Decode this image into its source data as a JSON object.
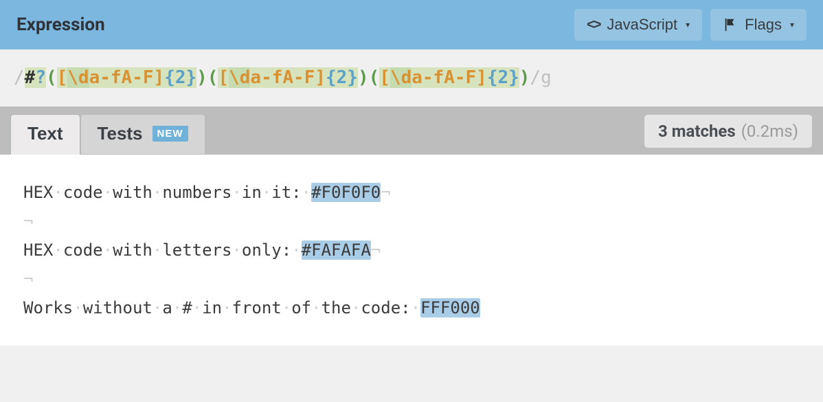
{
  "header": {
    "title": "Expression",
    "flavor_label": "JavaScript",
    "flags_label": "Flags"
  },
  "expression": {
    "open_delim": "/",
    "close_delim": "/",
    "flags": "g",
    "tokens": [
      {
        "t": "lit",
        "v": "#"
      },
      {
        "t": "qm",
        "v": "?"
      },
      {
        "t": "paren",
        "v": "("
      },
      {
        "t": "brk",
        "v": "["
      },
      {
        "t": "esc",
        "v": "\\d"
      },
      {
        "t": "brk",
        "v": "a-fA-F"
      },
      {
        "t": "brk",
        "v": "]"
      },
      {
        "t": "quant",
        "v": "{2}"
      },
      {
        "t": "paren",
        "v": ")"
      },
      {
        "t": "paren",
        "v": "("
      },
      {
        "t": "brk",
        "v": "["
      },
      {
        "t": "esc",
        "v": "\\d"
      },
      {
        "t": "brk",
        "v": "a-fA-F"
      },
      {
        "t": "brk",
        "v": "]"
      },
      {
        "t": "quant",
        "v": "{2}"
      },
      {
        "t": "paren",
        "v": ")"
      },
      {
        "t": "paren",
        "v": "("
      },
      {
        "t": "brk",
        "v": "["
      },
      {
        "t": "esc",
        "v": "\\d"
      },
      {
        "t": "brk",
        "v": "a-fA-F"
      },
      {
        "t": "brk",
        "v": "]"
      },
      {
        "t": "quant",
        "v": "{2}"
      },
      {
        "t": "paren",
        "v": ")"
      }
    ]
  },
  "tabs": {
    "text": "Text",
    "tests": "Tests",
    "new_badge": "NEW"
  },
  "results": {
    "count_label": "3 matches",
    "time_label": "(0.2ms)"
  },
  "test_text": {
    "lines": [
      [
        {
          "t": "c",
          "v": "HEX"
        },
        {
          "t": "w"
        },
        {
          "t": "c",
          "v": "code"
        },
        {
          "t": "w"
        },
        {
          "t": "c",
          "v": "with"
        },
        {
          "t": "w"
        },
        {
          "t": "c",
          "v": "numbers"
        },
        {
          "t": "w"
        },
        {
          "t": "c",
          "v": "in"
        },
        {
          "t": "w"
        },
        {
          "t": "c",
          "v": "it:"
        },
        {
          "t": "w"
        },
        {
          "t": "m",
          "v": "#F0F0F0"
        },
        {
          "t": "e"
        }
      ],
      [
        {
          "t": "e"
        }
      ],
      [
        {
          "t": "c",
          "v": "HEX"
        },
        {
          "t": "w"
        },
        {
          "t": "c",
          "v": "code"
        },
        {
          "t": "w"
        },
        {
          "t": "c",
          "v": "with"
        },
        {
          "t": "w"
        },
        {
          "t": "c",
          "v": "letters"
        },
        {
          "t": "w"
        },
        {
          "t": "c",
          "v": "only:"
        },
        {
          "t": "w"
        },
        {
          "t": "m",
          "v": "#FAFAFA"
        },
        {
          "t": "e"
        }
      ],
      [
        {
          "t": "e"
        }
      ],
      [
        {
          "t": "c",
          "v": "Works"
        },
        {
          "t": "w"
        },
        {
          "t": "c",
          "v": "without"
        },
        {
          "t": "w"
        },
        {
          "t": "c",
          "v": "a"
        },
        {
          "t": "w"
        },
        {
          "t": "c",
          "v": "#"
        },
        {
          "t": "w"
        },
        {
          "t": "c",
          "v": "in"
        },
        {
          "t": "w"
        },
        {
          "t": "c",
          "v": "front"
        },
        {
          "t": "w"
        },
        {
          "t": "c",
          "v": "of"
        },
        {
          "t": "w"
        },
        {
          "t": "c",
          "v": "the"
        },
        {
          "t": "w"
        },
        {
          "t": "c",
          "v": "code:"
        },
        {
          "t": "w"
        },
        {
          "t": "m",
          "v": "FFF000"
        }
      ]
    ]
  }
}
